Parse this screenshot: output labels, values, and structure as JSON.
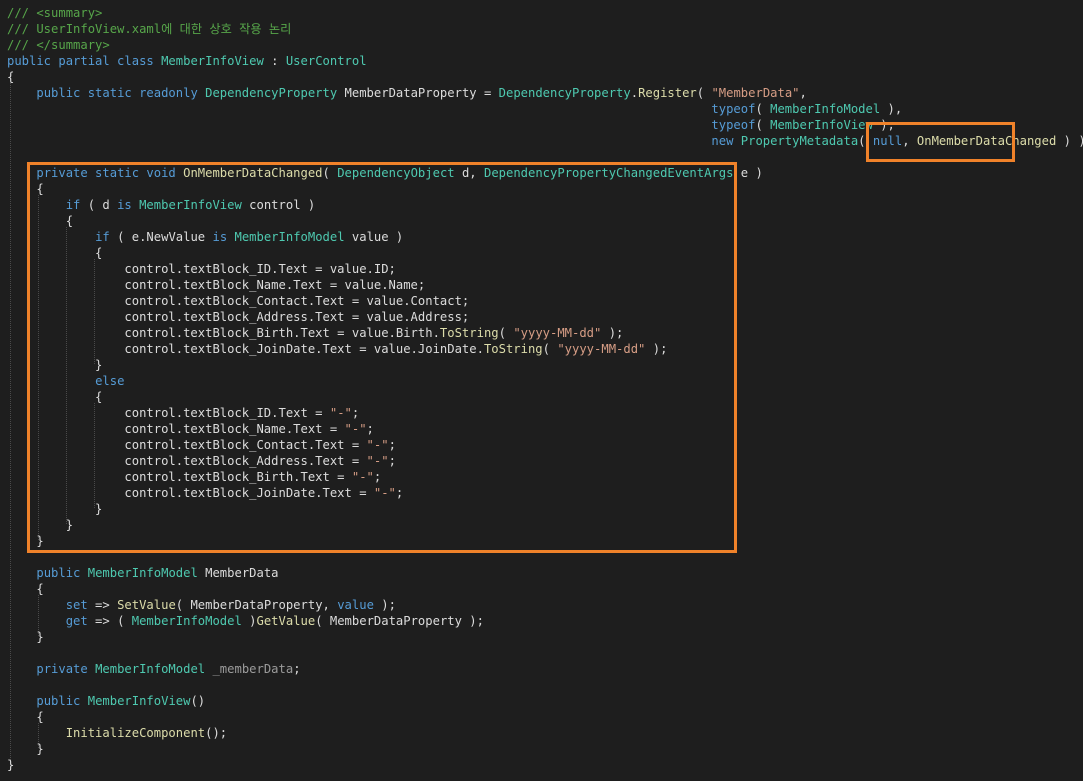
{
  "editor": {
    "language": "C#",
    "colors": {
      "background": "#1e1e1e",
      "comment": "#57a64a",
      "keyword": "#569cd6",
      "type": "#4ec9b0",
      "plain": "#dcdcdc",
      "string": "#d69d85",
      "method": "#dcdcaa",
      "highlight_box": "#f0822a"
    },
    "lines": [
      {
        "tokens": [
          [
            "c-comment",
            "/// <summary>"
          ]
        ]
      },
      {
        "tokens": [
          [
            "c-comment",
            "/// UserInfoView.xaml에 대한 상호 작용 논리"
          ]
        ]
      },
      {
        "tokens": [
          [
            "c-comment",
            "/// </summary>"
          ]
        ]
      },
      {
        "tokens": [
          [
            "c-kw",
            "public partial class "
          ],
          [
            "c-type",
            "MemberInfoView"
          ],
          [
            "c-plain",
            " : "
          ],
          [
            "c-type",
            "UserControl"
          ]
        ]
      },
      {
        "tokens": [
          [
            "c-plain",
            "{"
          ]
        ]
      },
      {
        "tokens": [
          [
            "c-plain",
            "    "
          ],
          [
            "c-kw",
            "public static readonly "
          ],
          [
            "c-type",
            "DependencyProperty"
          ],
          [
            "c-plain",
            " MemberDataProperty = "
          ],
          [
            "c-type",
            "DependencyProperty"
          ],
          [
            "c-plain",
            "."
          ],
          [
            "c-method",
            "Register"
          ],
          [
            "c-plain",
            "( "
          ],
          [
            "c-str",
            "\"MemberData\""
          ],
          [
            "c-plain",
            ","
          ]
        ]
      },
      {
        "tokens": [
          [
            "c-plain",
            "                                                                                                "
          ],
          [
            "c-kw",
            "typeof"
          ],
          [
            "c-plain",
            "( "
          ],
          [
            "c-type",
            "MemberInfoModel"
          ],
          [
            "c-plain",
            " ),"
          ]
        ]
      },
      {
        "tokens": [
          [
            "c-plain",
            "                                                                                                "
          ],
          [
            "c-kw",
            "typeof"
          ],
          [
            "c-plain",
            "( "
          ],
          [
            "c-type",
            "MemberInfoView"
          ],
          [
            "c-plain",
            " ),"
          ]
        ]
      },
      {
        "tokens": [
          [
            "c-plain",
            "                                                                                                "
          ],
          [
            "c-kw",
            "new "
          ],
          [
            "c-type",
            "PropertyMetadata"
          ],
          [
            "c-plain",
            "( "
          ],
          [
            "c-kw",
            "null"
          ],
          [
            "c-plain",
            ", "
          ],
          [
            "c-method",
            "OnMemberDataChanged"
          ],
          [
            "c-plain",
            " ) );"
          ]
        ]
      },
      {
        "tokens": []
      },
      {
        "tokens": [
          [
            "c-plain",
            "    "
          ],
          [
            "c-kw",
            "private static void "
          ],
          [
            "c-method",
            "OnMemberDataChanged"
          ],
          [
            "c-plain",
            "( "
          ],
          [
            "c-type",
            "DependencyObject"
          ],
          [
            "c-plain",
            " d, "
          ],
          [
            "c-type",
            "DependencyPropertyChangedEventArgs"
          ],
          [
            "c-plain",
            " e )"
          ]
        ]
      },
      {
        "tokens": [
          [
            "c-plain",
            "    {"
          ]
        ]
      },
      {
        "tokens": [
          [
            "c-plain",
            "        "
          ],
          [
            "c-kw",
            "if"
          ],
          [
            "c-plain",
            " ( d "
          ],
          [
            "c-kw",
            "is "
          ],
          [
            "c-type",
            "MemberInfoView"
          ],
          [
            "c-plain",
            " control )"
          ]
        ]
      },
      {
        "tokens": [
          [
            "c-plain",
            "        {"
          ]
        ]
      },
      {
        "tokens": [
          [
            "c-plain",
            "            "
          ],
          [
            "c-kw",
            "if"
          ],
          [
            "c-plain",
            " ( e.NewValue "
          ],
          [
            "c-kw",
            "is "
          ],
          [
            "c-type",
            "MemberInfoModel"
          ],
          [
            "c-plain",
            " value )"
          ]
        ]
      },
      {
        "tokens": [
          [
            "c-plain",
            "            {"
          ]
        ]
      },
      {
        "tokens": [
          [
            "c-plain",
            "                control.textBlock_ID.Text = value.ID;"
          ]
        ]
      },
      {
        "tokens": [
          [
            "c-plain",
            "                control.textBlock_Name.Text = value.Name;"
          ]
        ]
      },
      {
        "tokens": [
          [
            "c-plain",
            "                control.textBlock_Contact.Text = value.Contact;"
          ]
        ]
      },
      {
        "tokens": [
          [
            "c-plain",
            "                control.textBlock_Address.Text = value.Address;"
          ]
        ]
      },
      {
        "tokens": [
          [
            "c-plain",
            "                control.textBlock_Birth.Text = value.Birth."
          ],
          [
            "c-method",
            "ToString"
          ],
          [
            "c-plain",
            "( "
          ],
          [
            "c-str",
            "\"yyyy-MM-dd\""
          ],
          [
            "c-plain",
            " );"
          ]
        ]
      },
      {
        "tokens": [
          [
            "c-plain",
            "                control.textBlock_JoinDate.Text = value.JoinDate."
          ],
          [
            "c-method",
            "ToString"
          ],
          [
            "c-plain",
            "( "
          ],
          [
            "c-str",
            "\"yyyy-MM-dd\""
          ],
          [
            "c-plain",
            " );"
          ]
        ]
      },
      {
        "tokens": [
          [
            "c-plain",
            "            }"
          ]
        ]
      },
      {
        "tokens": [
          [
            "c-plain",
            "            "
          ],
          [
            "c-kw",
            "else"
          ]
        ]
      },
      {
        "tokens": [
          [
            "c-plain",
            "            {"
          ]
        ]
      },
      {
        "tokens": [
          [
            "c-plain",
            "                control.textBlock_ID.Text = "
          ],
          [
            "c-str",
            "\"-\""
          ],
          [
            "c-plain",
            ";"
          ]
        ]
      },
      {
        "tokens": [
          [
            "c-plain",
            "                control.textBlock_Name.Text = "
          ],
          [
            "c-str",
            "\"-\""
          ],
          [
            "c-plain",
            ";"
          ]
        ]
      },
      {
        "tokens": [
          [
            "c-plain",
            "                control.textBlock_Contact.Text = "
          ],
          [
            "c-str",
            "\"-\""
          ],
          [
            "c-plain",
            ";"
          ]
        ]
      },
      {
        "tokens": [
          [
            "c-plain",
            "                control.textBlock_Address.Text = "
          ],
          [
            "c-str",
            "\"-\""
          ],
          [
            "c-plain",
            ";"
          ]
        ]
      },
      {
        "tokens": [
          [
            "c-plain",
            "                control.textBlock_Birth.Text = "
          ],
          [
            "c-str",
            "\"-\""
          ],
          [
            "c-plain",
            ";"
          ]
        ]
      },
      {
        "tokens": [
          [
            "c-plain",
            "                control.textBlock_JoinDate.Text = "
          ],
          [
            "c-str",
            "\"-\""
          ],
          [
            "c-plain",
            ";"
          ]
        ]
      },
      {
        "tokens": [
          [
            "c-plain",
            "            }"
          ]
        ]
      },
      {
        "tokens": [
          [
            "c-plain",
            "        }"
          ]
        ]
      },
      {
        "tokens": [
          [
            "c-plain",
            "    }"
          ]
        ]
      },
      {
        "tokens": []
      },
      {
        "tokens": [
          [
            "c-plain",
            "    "
          ],
          [
            "c-kw",
            "public "
          ],
          [
            "c-type",
            "MemberInfoModel"
          ],
          [
            "c-plain",
            " MemberData"
          ]
        ]
      },
      {
        "tokens": [
          [
            "c-plain",
            "    {"
          ]
        ]
      },
      {
        "tokens": [
          [
            "c-plain",
            "        "
          ],
          [
            "c-kw",
            "set"
          ],
          [
            "c-plain",
            " => "
          ],
          [
            "c-method",
            "SetValue"
          ],
          [
            "c-plain",
            "( MemberDataProperty, "
          ],
          [
            "c-kw",
            "value"
          ],
          [
            "c-plain",
            " );"
          ]
        ]
      },
      {
        "tokens": [
          [
            "c-plain",
            "        "
          ],
          [
            "c-kw",
            "get"
          ],
          [
            "c-plain",
            " => ( "
          ],
          [
            "c-type",
            "MemberInfoModel"
          ],
          [
            "c-plain",
            " )"
          ],
          [
            "c-method",
            "GetValue"
          ],
          [
            "c-plain",
            "( MemberDataProperty );"
          ]
        ]
      },
      {
        "tokens": [
          [
            "c-plain",
            "    }"
          ]
        ]
      },
      {
        "tokens": []
      },
      {
        "tokens": [
          [
            "c-plain",
            "    "
          ],
          [
            "c-kw",
            "private "
          ],
          [
            "c-type",
            "MemberInfoModel"
          ],
          [
            "c-plain",
            " "
          ],
          [
            "c-gray",
            "_memberData"
          ],
          [
            "c-plain",
            ";"
          ]
        ]
      },
      {
        "tokens": []
      },
      {
        "tokens": [
          [
            "c-plain",
            "    "
          ],
          [
            "c-kw",
            "public "
          ],
          [
            "c-type",
            "MemberInfoView"
          ],
          [
            "c-plain",
            "()"
          ]
        ]
      },
      {
        "tokens": [
          [
            "c-plain",
            "    {"
          ]
        ]
      },
      {
        "tokens": [
          [
            "c-plain",
            "        "
          ],
          [
            "c-method",
            "InitializeComponent"
          ],
          [
            "c-plain",
            "();"
          ]
        ]
      },
      {
        "tokens": [
          [
            "c-plain",
            "    }"
          ]
        ]
      },
      {
        "tokens": [
          [
            "c-plain",
            "}"
          ]
        ]
      }
    ]
  }
}
